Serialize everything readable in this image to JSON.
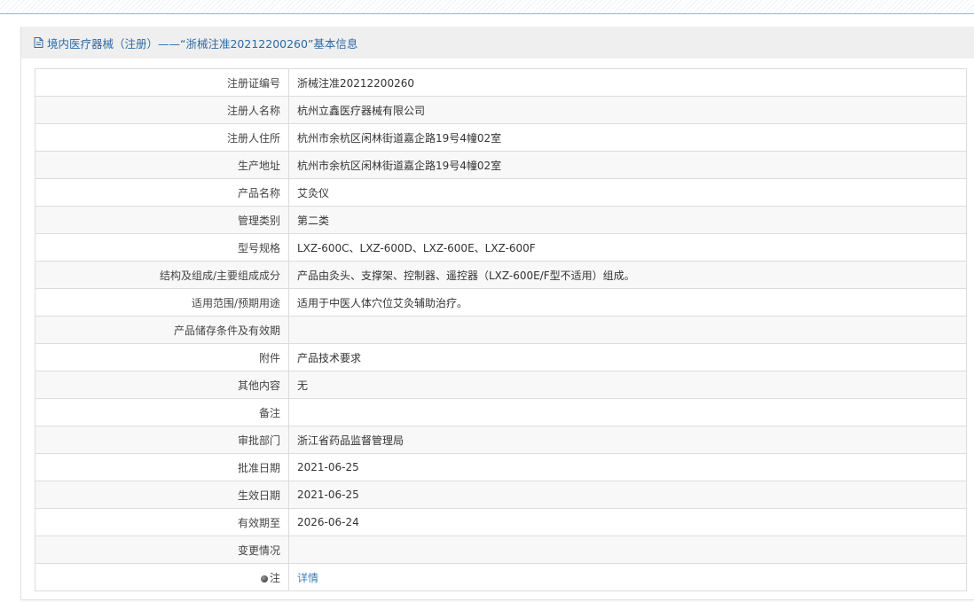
{
  "panel": {
    "title": "境内医疗器械（注册）——“浙械注准20212200260”基本信息"
  },
  "rows": [
    {
      "label": "注册证编号",
      "value": "浙械注准20212200260"
    },
    {
      "label": "注册人名称",
      "value": "杭州立鑫医疗器械有限公司"
    },
    {
      "label": "注册人住所",
      "value": "杭州市余杭区闲林街道嘉企路19号4幢02室"
    },
    {
      "label": "生产地址",
      "value": "杭州市余杭区闲林街道嘉企路19号4幢02室"
    },
    {
      "label": "产品名称",
      "value": "艾灸仪"
    },
    {
      "label": "管理类别",
      "value": "第二类"
    },
    {
      "label": "型号规格",
      "value": "LXZ-600C、LXZ-600D、LXZ-600E、LXZ-600F"
    },
    {
      "label": "结构及组成/主要组成成分",
      "value": "产品由灸头、支撑架、控制器、遥控器（LXZ-600E/F型不适用）组成。"
    },
    {
      "label": "适用范围/预期用途",
      "value": "适用于中医人体穴位艾灸辅助治疗。"
    },
    {
      "label": "产品储存条件及有效期",
      "value": ""
    },
    {
      "label": "附件",
      "value": "产品技术要求"
    },
    {
      "label": "其他内容",
      "value": "无"
    },
    {
      "label": "备注",
      "value": ""
    },
    {
      "label": "审批部门",
      "value": "浙江省药品监督管理局"
    },
    {
      "label": "批准日期",
      "value": "2021-06-25"
    },
    {
      "label": "生效日期",
      "value": "2021-06-25"
    },
    {
      "label": "有效期至",
      "value": "2026-06-24"
    },
    {
      "label": "变更情况",
      "value": ""
    }
  ],
  "note_row": {
    "label": "注",
    "link_text": "详情",
    "icon": "note-bullet-icon"
  },
  "colors": {
    "title": "#2b6aa6",
    "link": "#3d7fc1",
    "header_bg": "#efefef",
    "border": "#dcdcdc"
  }
}
